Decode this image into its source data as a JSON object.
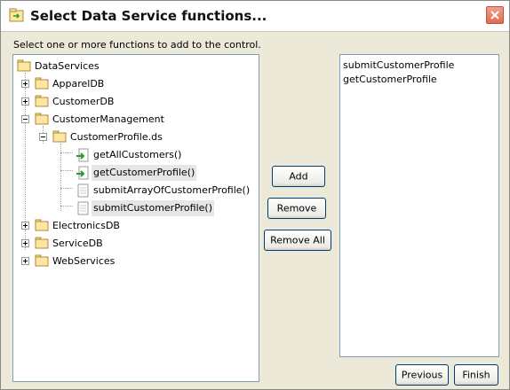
{
  "window": {
    "title": "Select Data Service functions...",
    "instruction": "Select one or more functions to add to the control."
  },
  "tree": {
    "root": "DataServices",
    "nodes": [
      {
        "label": "ApparelDB",
        "icon": "folder-icon",
        "expanded": false
      },
      {
        "label": "CustomerDB",
        "icon": "folder-icon",
        "expanded": false
      },
      {
        "label": "CustomerManagement",
        "icon": "folder-icon",
        "expanded": true
      },
      {
        "label": "CustomerProfile.ds",
        "icon": "folder-icon",
        "expanded": true
      },
      {
        "label": "getAllCustomers()",
        "icon": "method-arrow-icon"
      },
      {
        "label": "getCustomerProfile()",
        "icon": "method-arrow-icon",
        "highlighted": true
      },
      {
        "label": "submitArrayOfCustomerProfile()",
        "icon": "document-icon"
      },
      {
        "label": "submitCustomerProfile()",
        "icon": "document-icon",
        "highlighted": true
      },
      {
        "label": "ElectronicsDB",
        "icon": "folder-icon",
        "expanded": false
      },
      {
        "label": "ServiceDB",
        "icon": "folder-icon",
        "expanded": false
      },
      {
        "label": "WebServices",
        "icon": "folder-icon",
        "expanded": false
      }
    ]
  },
  "buttons": {
    "add": "Add",
    "remove": "Remove",
    "remove_all": "Remove All",
    "previous": "Previous",
    "finish": "Finish"
  },
  "selected_functions": [
    "submitCustomerProfile",
    "getCustomerProfile"
  ],
  "colors": {
    "dialog_bg": "#ece9d8",
    "panel_border": "#7f9db9",
    "close_button": "#e06a4f",
    "highlight_bg": "#e6e6e6",
    "method_arrow": "#2a9a2a"
  }
}
